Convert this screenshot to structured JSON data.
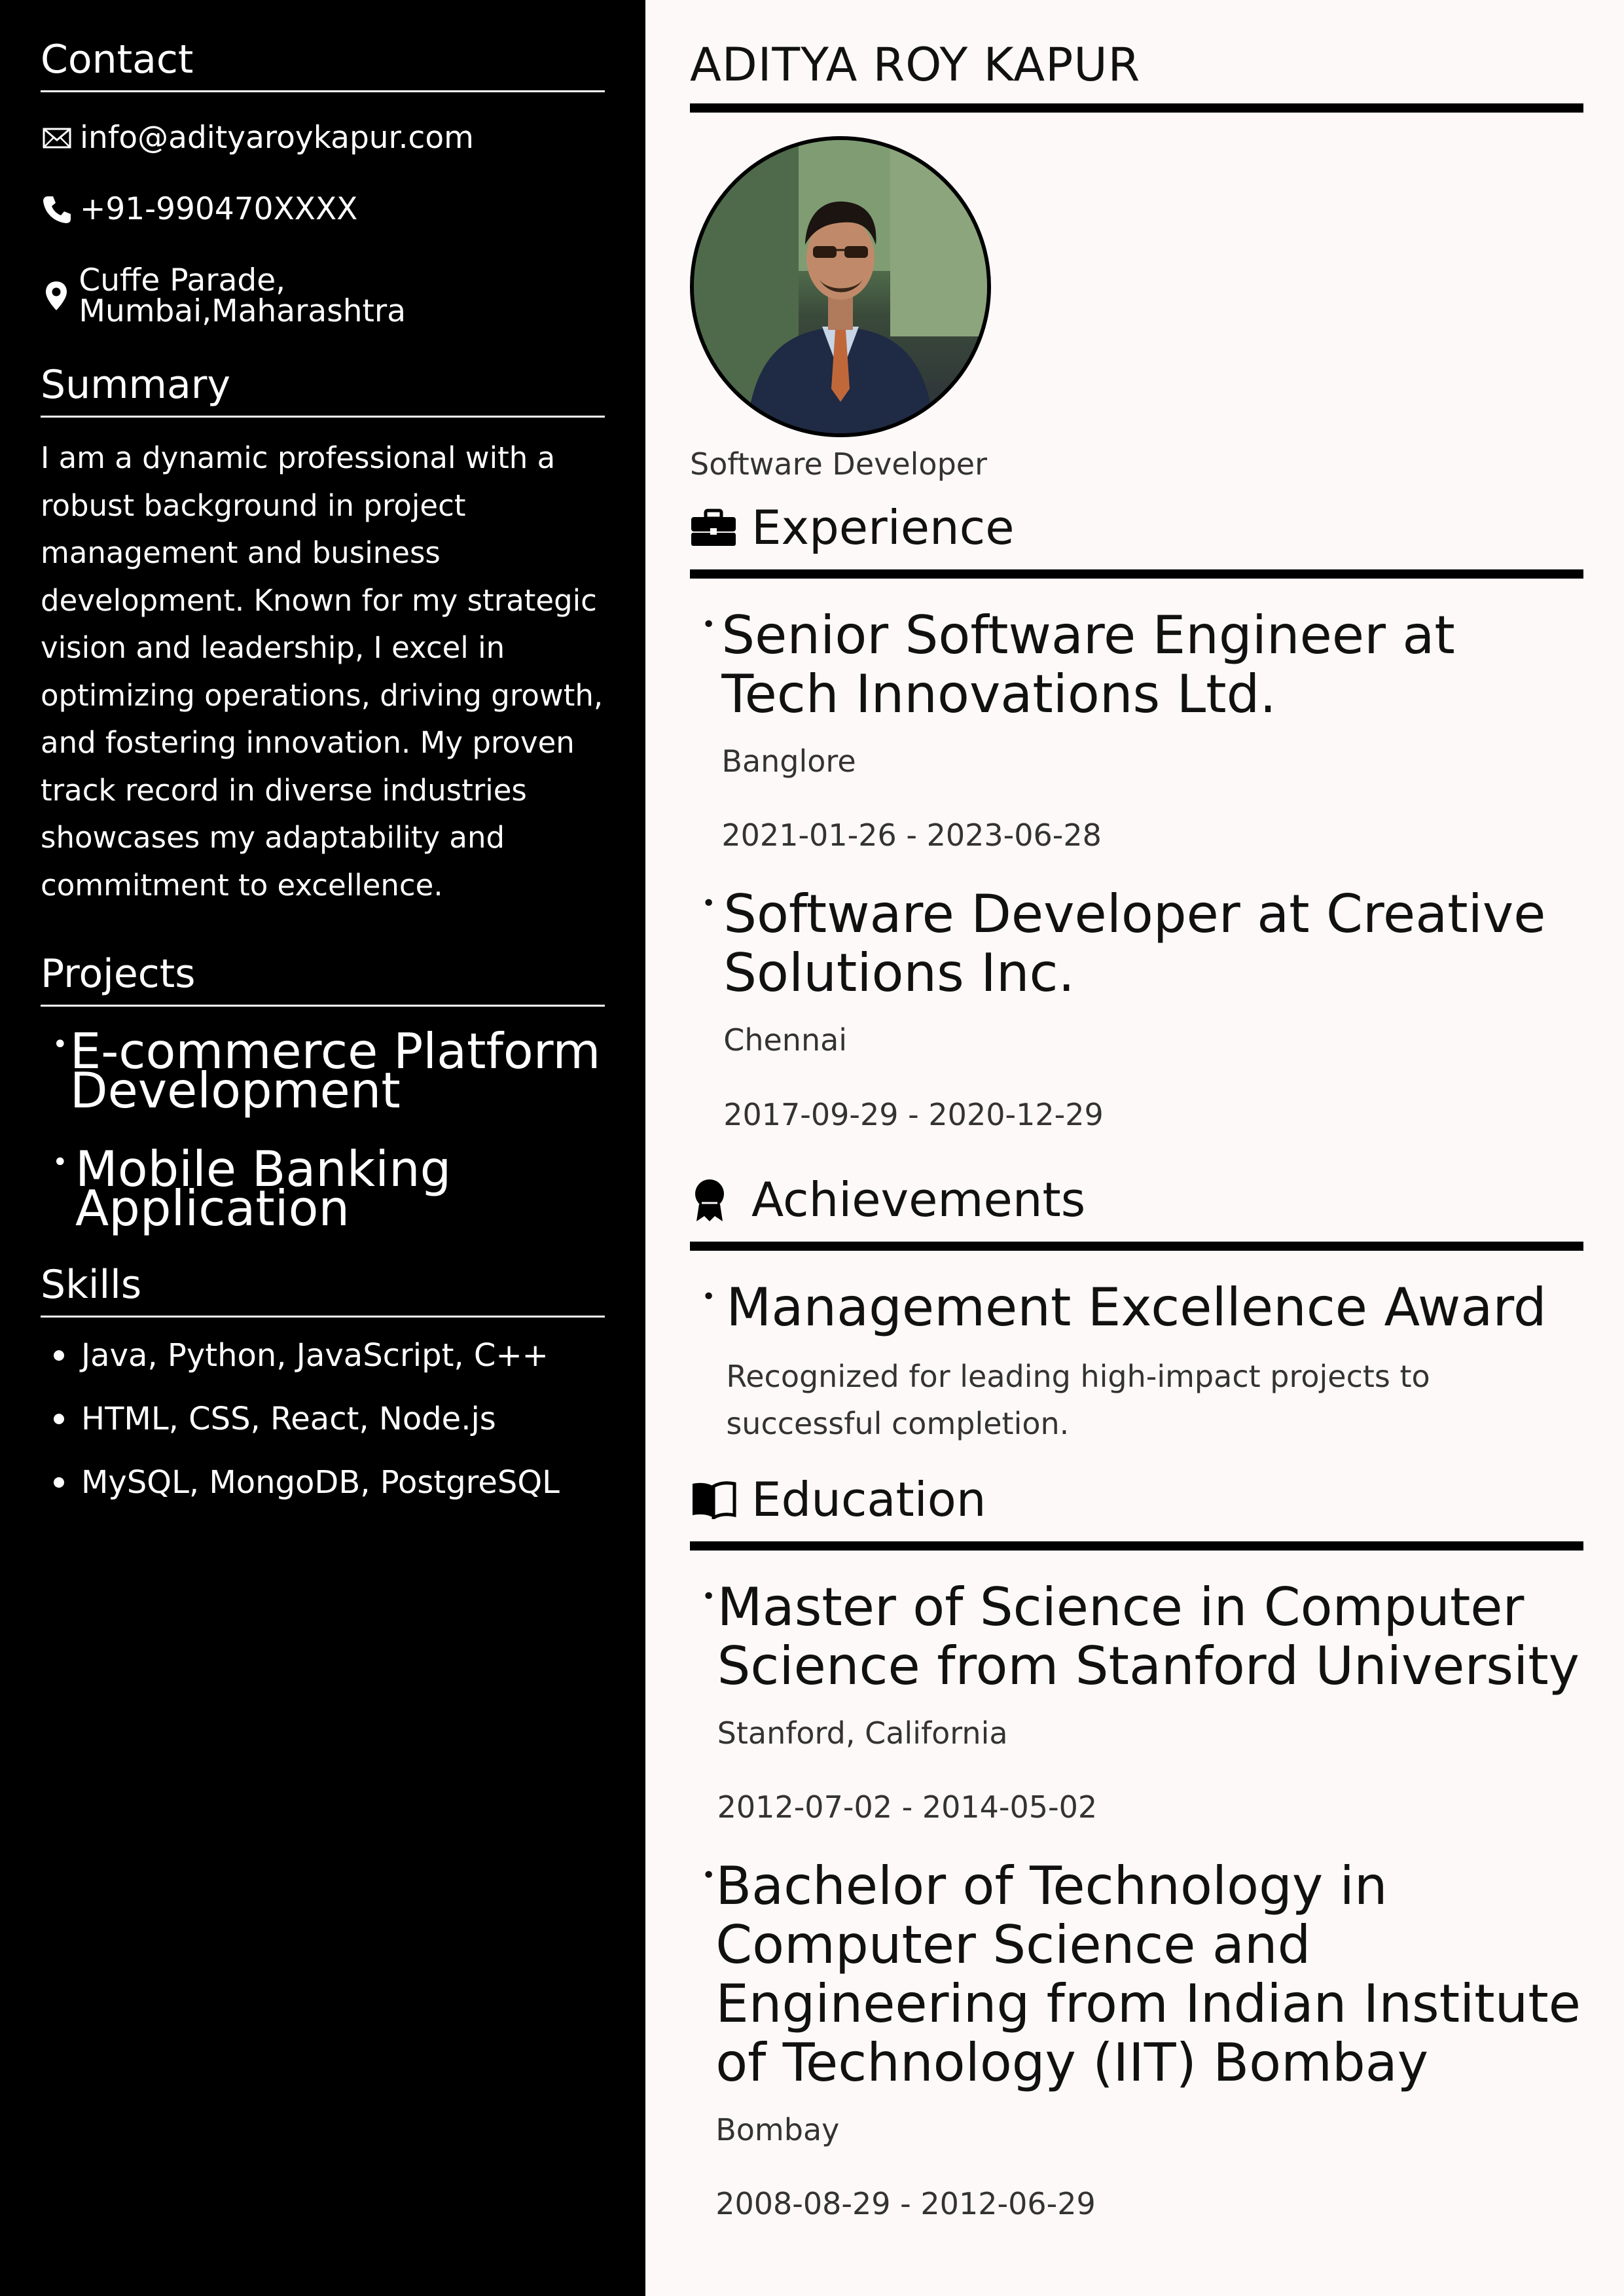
{
  "contact": {
    "heading": "Contact",
    "email": "info@adityaroykapur.com",
    "phone": "+91-990470XXXX",
    "address": "Cuffe Parade, Mumbai,Maharashtra"
  },
  "summary": {
    "heading": "Summary",
    "text": "I am a dynamic professional with a robust background in project management and business development. Known for my strategic vision and leadership, I excel in optimizing operations, driving growth, and fostering innovation. My proven track record in diverse industries showcases my adaptability and commitment to excellence."
  },
  "projects": {
    "heading": "Projects",
    "items": [
      "E-commerce Platform Development",
      "Mobile Banking Application"
    ]
  },
  "skills": {
    "heading": "Skills",
    "items": [
      "Java, Python, JavaScript, C++",
      "HTML, CSS, React, Node.js",
      "MySQL, MongoDB, PostgreSQL"
    ]
  },
  "profile": {
    "name": "ADITYA ROY KAPUR",
    "role": "Software Developer"
  },
  "experience": {
    "heading": "Experience",
    "items": [
      {
        "title": "Senior Software Engineer at Tech Innovations Ltd.",
        "location": "Banglore",
        "dates": "2021-01-26 - 2023-06-28"
      },
      {
        "title": "Software Developer at Creative Solutions Inc.",
        "location": "Chennai",
        "dates": "2017-09-29 - 2020-12-29"
      }
    ]
  },
  "achievements": {
    "heading": "Achievements",
    "items": [
      {
        "title": "Management Excellence Award",
        "description": "Recognized for leading high-impact projects to successful completion."
      }
    ]
  },
  "education": {
    "heading": "Education",
    "items": [
      {
        "title": "Master of Science in Computer Science from Stanford University",
        "location": "Stanford, California",
        "dates": "2012-07-02 - 2014-05-02"
      },
      {
        "title": "Bachelor of Technology in Computer Science and Engineering from Indian Institute of Technology (IIT) Bombay",
        "location": "Bombay",
        "dates": "2008-08-29 - 2012-06-29"
      }
    ]
  },
  "icons": {
    "email": "envelope-icon",
    "phone": "phone-icon",
    "address": "map-pin-icon",
    "experience": "briefcase-icon",
    "achievements": "award-icon",
    "education": "book-icon"
  }
}
